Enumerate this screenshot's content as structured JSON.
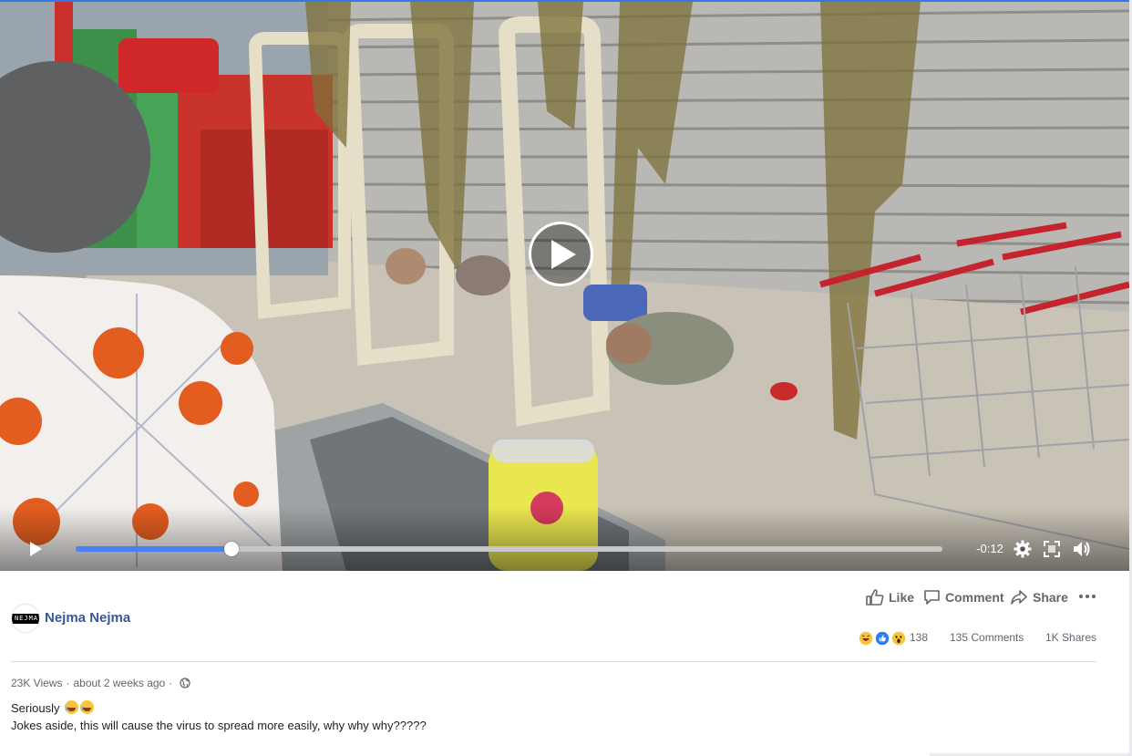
{
  "video": {
    "remaining_time": "-0:12",
    "progress_fraction": 0.18,
    "icons": {
      "big_play": "play-icon",
      "play": "play-icon",
      "settings": "gear-icon",
      "fullscreen": "fullscreen-icon",
      "volume": "volume-icon"
    }
  },
  "post": {
    "author": "Nejma Nejma",
    "avatar_text": "NEJMA",
    "actions": {
      "like": "Like",
      "comment": "Comment",
      "share": "Share"
    },
    "reaction_count": "138",
    "comments": "135 Comments",
    "shares": "1K Shares",
    "views": "23K Views",
    "separator": "·",
    "time_ago": "about 2 weeks ago",
    "caption_line1": "Seriously",
    "caption_line2": "Jokes aside, this will cause the virus to spread more easily, why why why?????"
  },
  "colors": {
    "accent": "#4a80f5",
    "link": "#385898",
    "muted": "#606770"
  }
}
